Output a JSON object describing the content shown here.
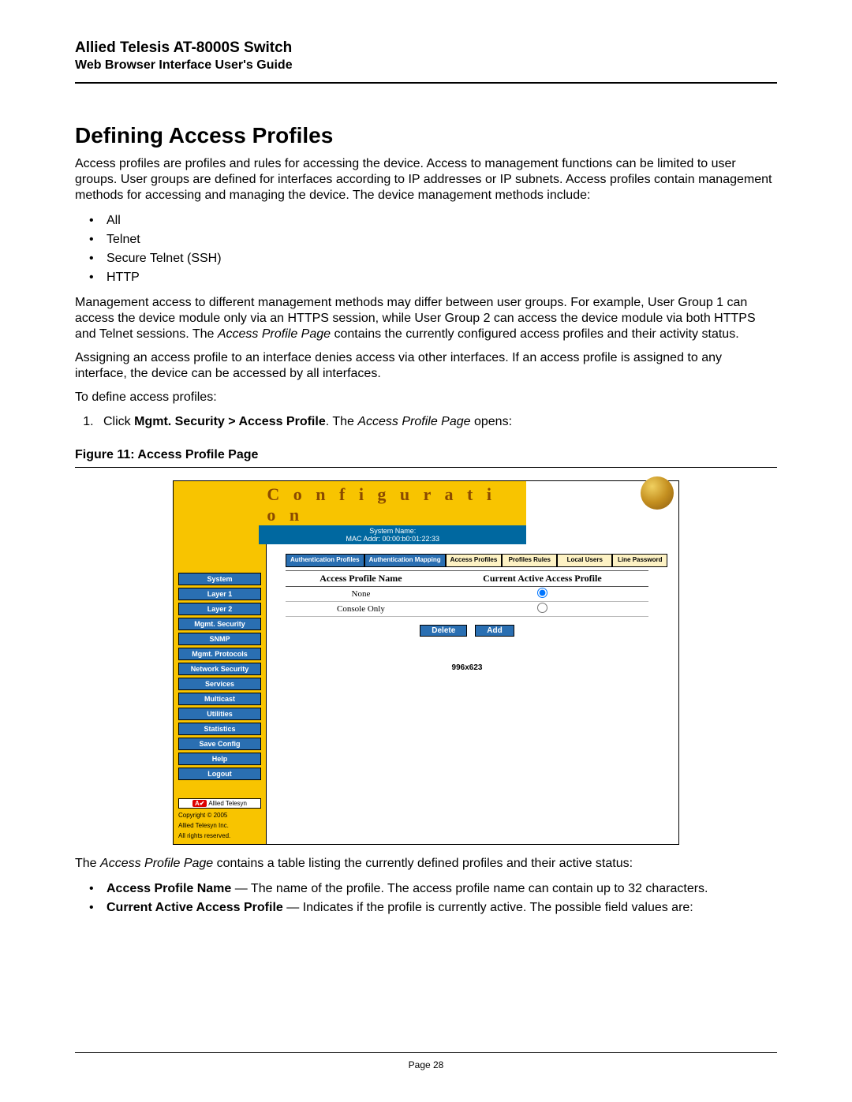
{
  "header": {
    "title": "Allied Telesis AT-8000S Switch",
    "subtitle": "Web Browser Interface User's Guide"
  },
  "heading": "Defining Access Profiles",
  "intro": "Access profiles are profiles and rules for accessing the device. Access to management functions can be limited to user groups. User groups are defined for interfaces according to IP addresses or IP subnets. Access profiles contain management methods for accessing and managing the device. The device management methods include:",
  "methods": [
    "All",
    "Telnet",
    "Secure Telnet (SSH)",
    "HTTP"
  ],
  "para2_a": "Management access to different management methods may differ between user groups. For example, User Group 1 can access the device module only via an HTTPS session, while User Group 2 can access the device module via both HTTPS and Telnet sessions. The ",
  "para2_b": "Access Profile Page",
  "para2_c": " contains the currently configured access profiles and their activity status.",
  "para3": "Assigning an access profile to an interface denies access via other interfaces. If an access profile is assigned to any interface, the device can be accessed by all interfaces.",
  "para4": "To define access profiles:",
  "step1_a": "Click ",
  "step1_b": "Mgmt. Security > Access Profile",
  "step1_c": ". The ",
  "step1_d": "Access Profile Page",
  "step1_e": " opens:",
  "figure_caption": "Figure 11:  Access Profile Page",
  "figure": {
    "banner": "C o n f i g u r a t i o n",
    "system_name": "System Name:",
    "mac": "MAC Addr: 00:00:b0:01:22:33",
    "sidebar": [
      "System",
      "Layer 1",
      "Layer 2",
      "Mgmt. Security",
      "SNMP",
      "Mgmt. Protocols",
      "Network Security",
      "Services",
      "Multicast",
      "Utilities",
      "Statistics",
      "Save Config",
      "Help",
      "Logout"
    ],
    "brand": "Allied Telesyn",
    "copyright1": "Copyright © 2005",
    "copyright2": "Allied Telesyn Inc.",
    "copyright3": "All rights reserved.",
    "tabs": [
      {
        "label": "Authentication Profiles",
        "style": "blue"
      },
      {
        "label": "Authentication Mapping",
        "style": "blue"
      },
      {
        "label": "Access Profiles",
        "style": "cream"
      },
      {
        "label": "Profiles Rules",
        "style": "cream"
      },
      {
        "label": "Local Users",
        "style": "cream"
      },
      {
        "label": "Line Password",
        "style": "cream"
      }
    ],
    "table": {
      "col1": "Access Profile Name",
      "col2": "Current Active Access Profile",
      "rows": [
        {
          "name": "None",
          "active": true
        },
        {
          "name": "Console Only",
          "active": false
        }
      ]
    },
    "buttons": {
      "delete": "Delete",
      "add": "Add"
    },
    "dim": "996x623"
  },
  "after_fig_a": "The ",
  "after_fig_b": "Access Profile Page",
  "after_fig_c": " contains a table listing the currently defined profiles and their active status:",
  "def1_a": "Access Profile Name",
  "def1_b": " — The name of the profile. The access profile name can contain up to 32 characters.",
  "def2_a": "Current Active Access Profile",
  "def2_b": " — Indicates if the profile is currently active. The possible field values are:",
  "page_number": "Page 28"
}
